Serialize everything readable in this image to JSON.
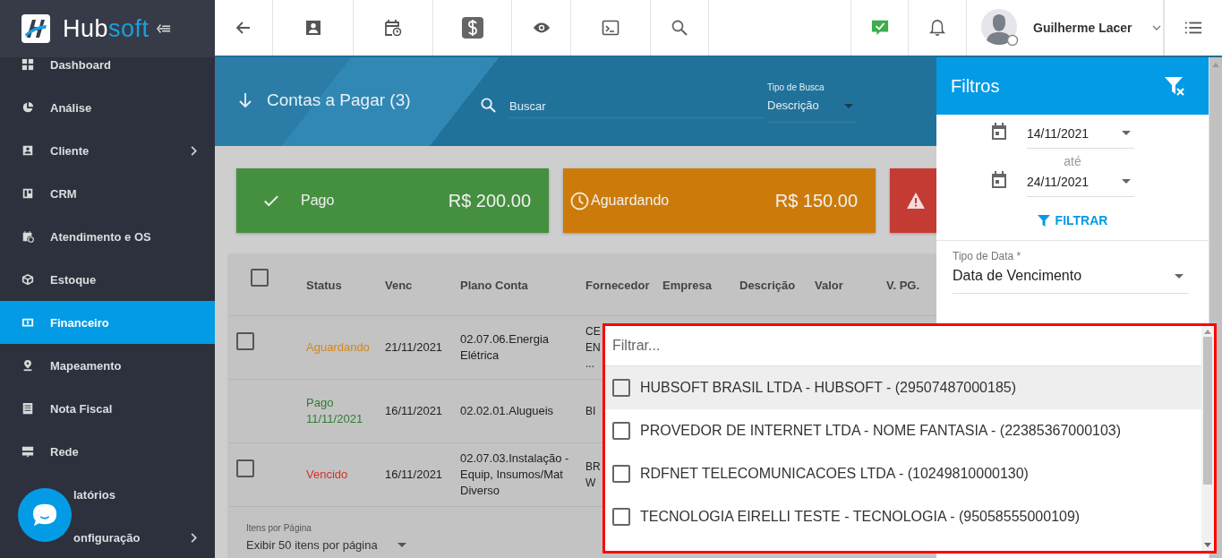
{
  "logo": {
    "part_1": "Hub",
    "part_2": "soft"
  },
  "sidebar": {
    "items": [
      {
        "label": "Dashboard",
        "selected": false,
        "has_submenu": false,
        "covered": false
      },
      {
        "label": "Análise",
        "selected": false,
        "has_submenu": false,
        "covered": false
      },
      {
        "label": "Cliente",
        "selected": false,
        "has_submenu": true,
        "covered": false
      },
      {
        "label": "CRM",
        "selected": false,
        "has_submenu": false,
        "covered": false
      },
      {
        "label": "Atendimento e OS",
        "selected": false,
        "has_submenu": false,
        "covered": false
      },
      {
        "label": "Estoque",
        "selected": false,
        "has_submenu": false,
        "covered": false
      },
      {
        "label": "Financeiro",
        "selected": true,
        "has_submenu": false,
        "covered": false
      },
      {
        "label": "Mapeamento",
        "selected": false,
        "has_submenu": false,
        "covered": false
      },
      {
        "label": "Nota Fiscal",
        "selected": false,
        "has_submenu": false,
        "covered": false
      },
      {
        "label": "Rede",
        "selected": false,
        "has_submenu": false,
        "covered": false
      },
      {
        "label": "latórios",
        "selected": false,
        "has_submenu": false,
        "covered": true
      },
      {
        "label": "onfiguração",
        "selected": false,
        "has_submenu": true,
        "covered": true
      }
    ]
  },
  "user": {
    "name": "Guilherme Lacer"
  },
  "page": {
    "title": "Contas a Pagar (3)",
    "search": {
      "placeholder": "Buscar"
    },
    "search_type": {
      "label": "Tipo de Busca",
      "value": "Descrição"
    }
  },
  "summary_cards": [
    {
      "kind": "paid",
      "label": "Pago",
      "amount": "R$ 200.00"
    },
    {
      "kind": "pending",
      "label": "Aguardando",
      "amount": "R$ 150.00"
    },
    {
      "kind": "overdue"
    }
  ],
  "table": {
    "select_all_checked": false,
    "columns": [
      "Status",
      "Venc",
      "Plano Conta",
      "Fornecedor",
      "Empresa",
      "Descrição",
      "Valor",
      "V. PG."
    ],
    "rows": [
      {
        "selectable": true,
        "checked": false,
        "status": "Aguardando",
        "color": "#d4861a",
        "venc": "21/11/2021",
        "plano_conta": "02.07.06.Energia Elétrica",
        "fornecedor": "CE\nEN\n..."
      },
      {
        "selectable": false,
        "status": "Pago 11/11/2021",
        "color": "#2e7d32",
        "venc": "16/11/2021",
        "plano_conta": "02.02.01.Alugueis",
        "fornecedor": "BI"
      },
      {
        "selectable": true,
        "checked": false,
        "status": "Vencido",
        "color": "#d32f2f",
        "venc": "16/11/2021",
        "plano_conta": "02.07.03.Instalação - Equip, Insumos/Mat Diverso",
        "fornecedor": "BR\nW"
      }
    ]
  },
  "pagination": {
    "label": "Itens por Página",
    "value": "Exibir 50 itens por página"
  },
  "filters": {
    "title": "Filtros",
    "date_from": "14/11/2021",
    "separator": "até",
    "date_to": "24/11/2021",
    "apply": "FILTRAR",
    "date_type": {
      "label": "Tipo de Data *",
      "value": "Data de Vencimento"
    }
  },
  "company_dropdown": {
    "placeholder": "Filtrar...",
    "options": [
      {
        "label": "HUBSOFT BRASIL LTDA - HUBSOFT - (29507487000185)",
        "checked": false,
        "highlighted": true
      },
      {
        "label": "PROVEDOR DE INTERNET LTDA - NOME FANTASIA - (22385367000103)",
        "checked": false,
        "highlighted": false
      },
      {
        "label": "RDFNET TELECOMUNICACOES LTDA - (10249810000130)",
        "checked": false,
        "highlighted": false
      },
      {
        "label": "TECNOLOGIA EIRELLI TESTE - TECNOLOGIA - (95058555000109)",
        "checked": false,
        "highlighted": false
      }
    ]
  }
}
